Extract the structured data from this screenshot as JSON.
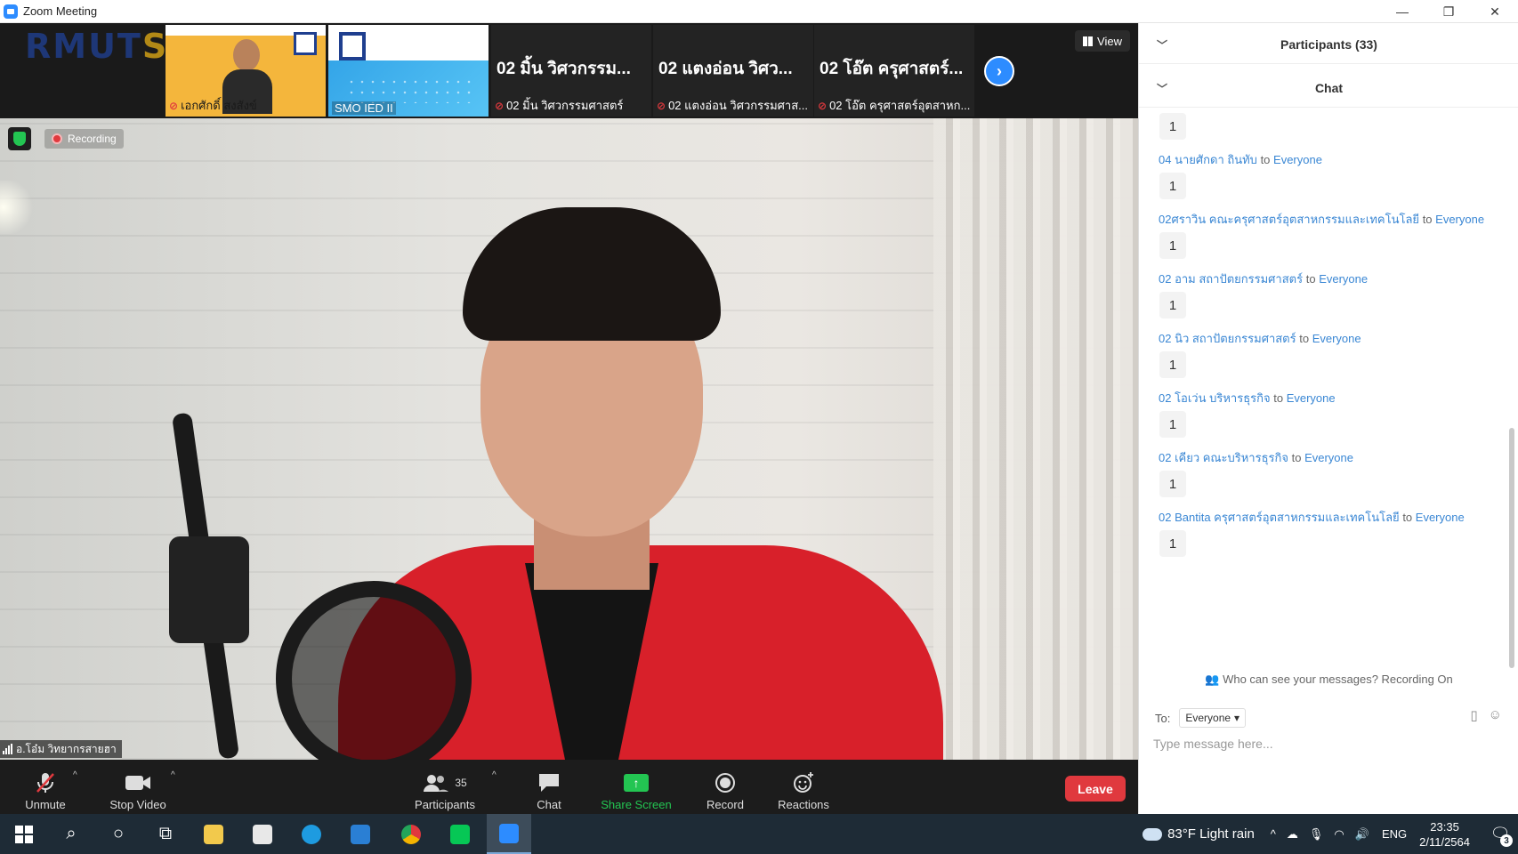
{
  "window": {
    "title": "Zoom Meeting",
    "controls": [
      "—",
      "❐",
      "✕"
    ]
  },
  "gallery": {
    "tiles": [
      {
        "label": "เอกศักดิ์ สงสังข์",
        "muted": true
      },
      {
        "label": "SMO IED II",
        "muted": false
      },
      {
        "big": "02 มิ้น วิศวกรรม...",
        "label": "02 มิ้น วิศวกรรมศาสตร์",
        "muted": true
      },
      {
        "big": "02 แตงอ่อน วิศว...",
        "label": "02 แตงอ่อน วิศวกรรมศาส...",
        "muted": true
      },
      {
        "big": "02 โอ๊ต ครุศาสตร์...",
        "label": "02 โอ๊ต ครุศาสตร์อุตสาหก...",
        "muted": true
      }
    ],
    "view_label": "View"
  },
  "main_video": {
    "recording_label": "Recording",
    "speaker_name": "อ.โอ๋ม วิทยากรสายฮา"
  },
  "toolbar": {
    "unmute": "Unmute",
    "stop_video": "Stop Video",
    "participants": "Participants",
    "participants_count": "35",
    "chat": "Chat",
    "share_screen": "Share Screen",
    "record": "Record",
    "reactions": "Reactions",
    "leave": "Leave"
  },
  "sidebar": {
    "participants_header": "Participants (33)",
    "chat_header": "Chat",
    "to_word": "to",
    "first_message": "1",
    "messages": [
      {
        "sender": "04 นายศักดา ถินทับ",
        "recipient": "Everyone",
        "text": "1"
      },
      {
        "sender": "02ศราวิน คณะครุศาสตร์อุตสาหกรรมและเทคโนโลยี",
        "recipient": "Everyone",
        "text": "1"
      },
      {
        "sender": "02 อาม สถาปัตยกรรมศาสตร์",
        "recipient": "Everyone",
        "text": "1"
      },
      {
        "sender": "02 นิว สถาปัตยกรรมศาสตร์",
        "recipient": "Everyone",
        "text": "1"
      },
      {
        "sender": "02 โอเว่น บริหารธุรกิจ",
        "recipient": "Everyone",
        "text": "1"
      },
      {
        "sender": "02 เคียว คณะบริหารธุรกิจ",
        "recipient": "Everyone",
        "text": "1"
      },
      {
        "sender": "02 Bantita ครุศาสตร์อุตสาหกรรมและเทคโนโลยี",
        "recipient": "Everyone",
        "text": "1"
      }
    ],
    "privacy_note": "Who can see your messages? Recording On",
    "to_label": "To:",
    "to_value": "Everyone",
    "input_placeholder": "Type message here..."
  },
  "taskbar": {
    "weather": "83°F  Light rain",
    "language": "ENG",
    "time": "23:35",
    "date": "2/11/2564",
    "notification_count": "3"
  },
  "colors": {
    "accent": "#2d8cff",
    "leave": "#e0393e",
    "share": "#23c552",
    "chat_name": "#3a87d4"
  }
}
